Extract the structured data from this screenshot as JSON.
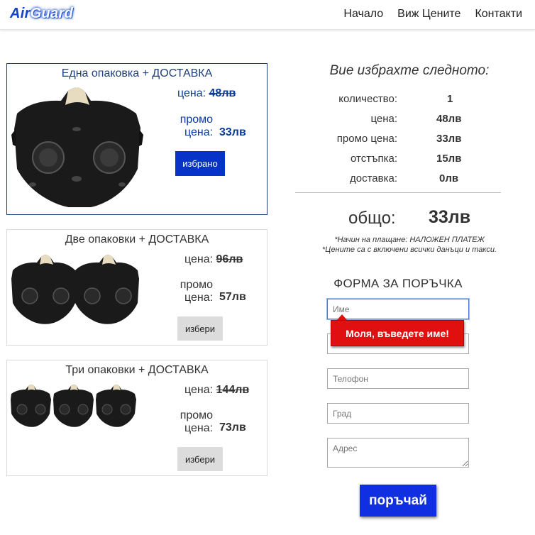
{
  "header": {
    "logo_part1": "Air",
    "logo_part2": "Guard",
    "nav": [
      "Начало",
      "Виж Цените",
      "Контакти"
    ]
  },
  "packages": [
    {
      "title": "Една опаковка + ДОСТАВКА",
      "price_label": "цена:",
      "old_price": "48лв",
      "promo_label_1": "промо",
      "promo_label_2": "цена:",
      "promo_price": "33лв",
      "button": "избрано",
      "selected": true,
      "mask_count": 1
    },
    {
      "title": "Две опаковки + ДОСТАВКА",
      "price_label": "цена:",
      "old_price": "96лв",
      "promo_label_1": "промо",
      "promo_label_2": "цена:",
      "promo_price": "57лв",
      "button": "избери",
      "selected": false,
      "mask_count": 2
    },
    {
      "title": "Три опаковки + ДОСТАВКА",
      "price_label": "цена:",
      "old_price": "144лв",
      "promo_label_1": "промо",
      "promo_label_2": "цена:",
      "promo_price": "73лв",
      "button": "избери",
      "selected": false,
      "mask_count": 3
    }
  ],
  "summary": {
    "title": "Вие избрахте следното:",
    "rows": [
      {
        "label": "количество:",
        "value": "1"
      },
      {
        "label": "цена:",
        "value": "48лв"
      },
      {
        "label": "промо цена:",
        "value": "33лв"
      },
      {
        "label": "отстъпка:",
        "value": "15лв"
      },
      {
        "label": "доставка:",
        "value": "0лв"
      }
    ],
    "total_label": "общо:",
    "total_value": "33лв",
    "note_payment": "*Начин на плащане: НАЛОЖЕН ПЛАТЕЖ",
    "note_taxes": "*Цените са с включени всички данъци и такси."
  },
  "form": {
    "title": "ФОРМА ЗА ПОРЪЧКА",
    "name_placeholder": "Име",
    "surname_placeholder": "",
    "phone_placeholder": "Телофон",
    "city_placeholder": "Град",
    "address_placeholder": "Адрес",
    "validation_message": "Моля, въведете име!",
    "submit": "поръчай"
  },
  "colors": {
    "brand_blue": "#0833c9",
    "selected_border": "#1f3f7a",
    "error_red": "#e01010"
  }
}
